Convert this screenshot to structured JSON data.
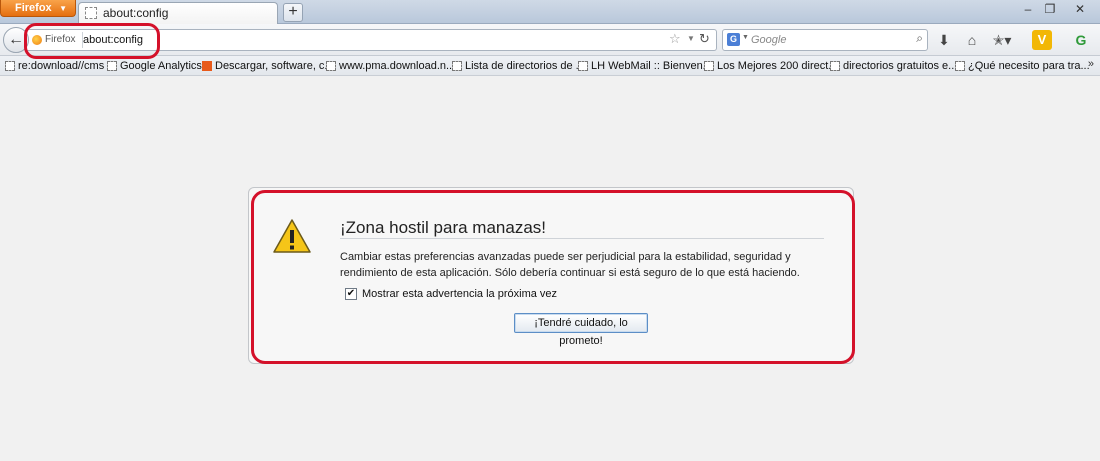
{
  "browser": {
    "menu_label": "Firefox",
    "tab_title": "about:config",
    "new_tab_label": "+",
    "window_controls": {
      "minimize": "–",
      "restore": "❐",
      "close": "✕"
    }
  },
  "navbar": {
    "back_icon": "back-arrow-icon",
    "identity_label": "Firefox",
    "url": "about:config",
    "search_engine": "G",
    "search_placeholder": "Google"
  },
  "toolbar_icons": [
    "download-icon",
    "home-icon",
    "bookmarks-menu-icon",
    "v-addon-icon",
    "green-addon-icon"
  ],
  "bookmarks": [
    {
      "label": "re:download//cms",
      "icon": "page"
    },
    {
      "label": "Google Analytics",
      "icon": "page"
    },
    {
      "label": "Descargar, software, c...",
      "icon": "orange"
    },
    {
      "label": "www.pma.download.n...",
      "icon": "page"
    },
    {
      "label": "Lista de directorios de ...",
      "icon": "page"
    },
    {
      "label": "LH WebMail :: Bienven...",
      "icon": "page"
    },
    {
      "label": "Los Mejores 200 direct...",
      "icon": "page"
    },
    {
      "label": "directorios gratuitos e...",
      "icon": "page"
    },
    {
      "label": "¿Qué necesito para tra...",
      "icon": "page"
    }
  ],
  "bookmarks_overflow": "»",
  "warning": {
    "title": "¡Zona hostil para manazas!",
    "text": "Cambiar estas preferencias avanzadas puede ser perjudicial para la estabilidad, seguridad y rendimiento de esta aplicación. Sólo debería continuar si está seguro de lo que está haciendo.",
    "checkbox_label": "Mostrar esta advertencia la próxima vez",
    "checkbox_checked": true,
    "button_label": "¡Tendré cuidado, lo prometo!"
  },
  "colors": {
    "annotation": "#d4112a",
    "firefox_orange": "#e56f10"
  }
}
